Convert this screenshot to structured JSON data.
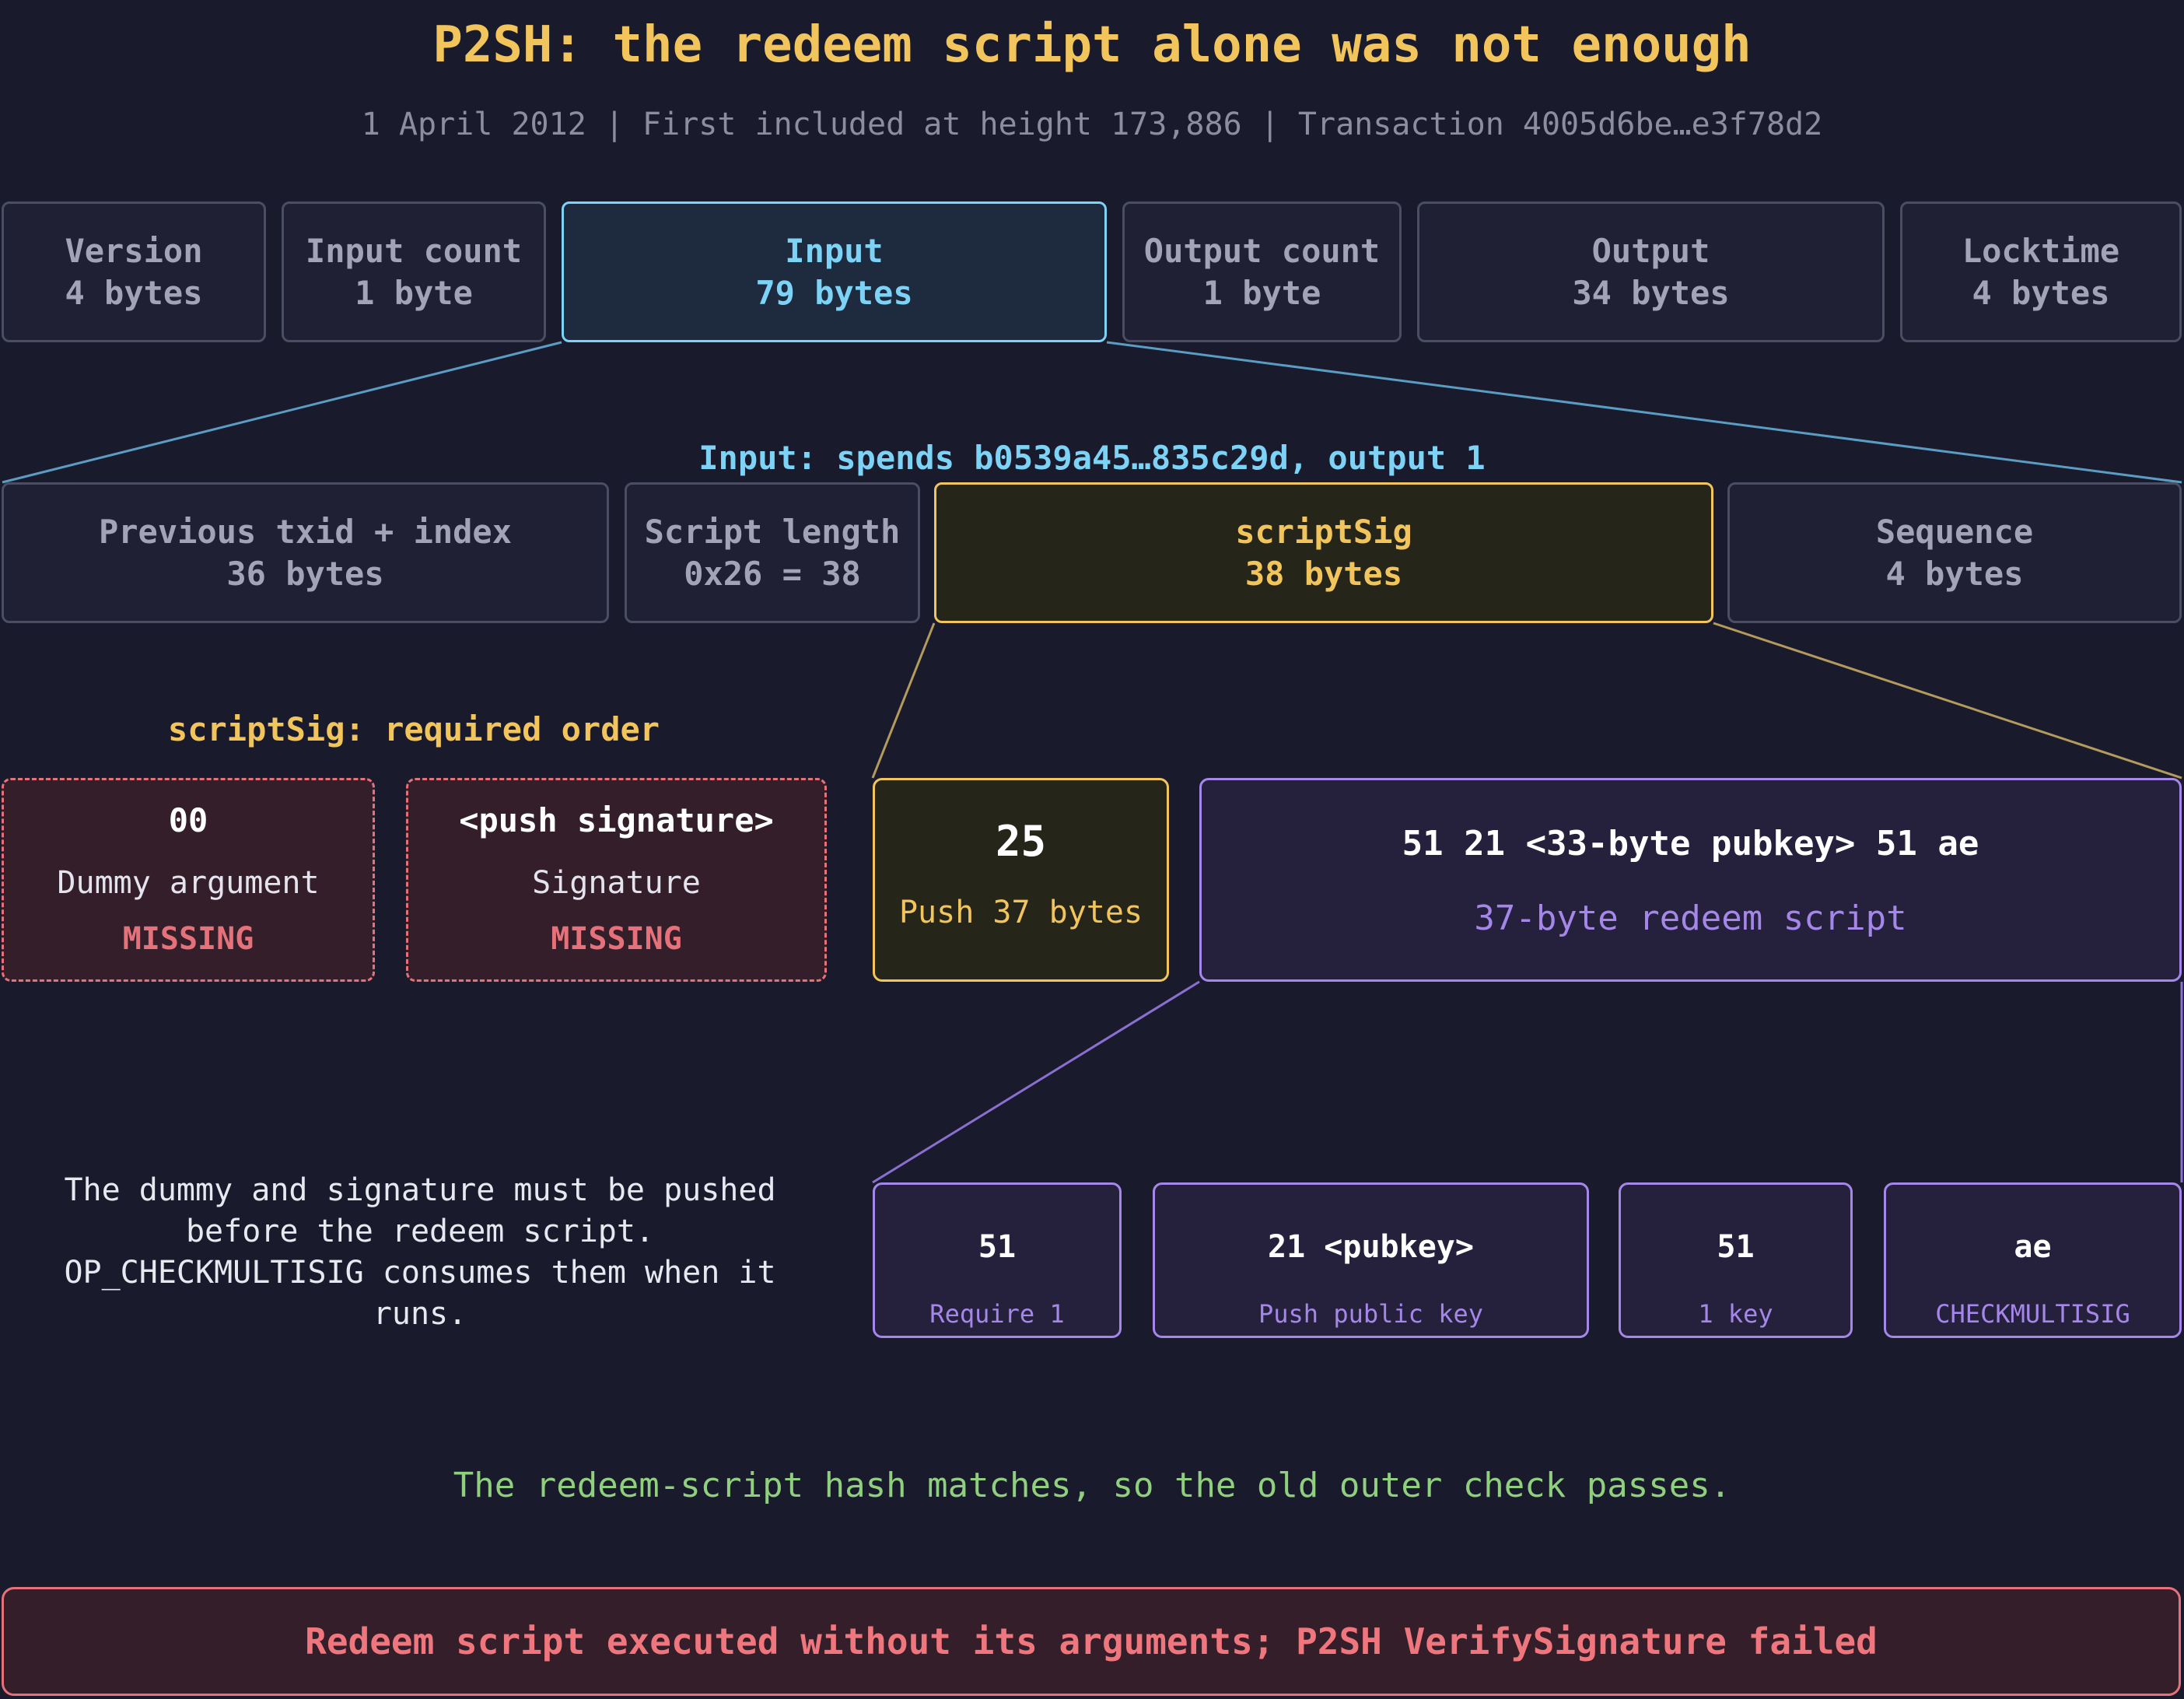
{
  "title": "P2SH: the redeem script alone was not enough",
  "subtitle": "1 April 2012 | First included at height 173,886 | Transaction 4005d6be…e3f78d2",
  "transaction_fields": [
    {
      "name": "Version",
      "size": "4 bytes"
    },
    {
      "name": "Input count",
      "size": "1 byte"
    },
    {
      "name": "Input",
      "size": "79 bytes"
    },
    {
      "name": "Output count",
      "size": "1 byte"
    },
    {
      "name": "Output",
      "size": "34 bytes"
    },
    {
      "name": "Locktime",
      "size": "4 bytes"
    }
  ],
  "input_caption": "Input: spends b0539a45…835c29d, output 1",
  "input_fields": [
    {
      "name": "Previous txid + index",
      "size": "36 bytes"
    },
    {
      "name": "Script length",
      "size": "0x26 = 38"
    },
    {
      "name": "scriptSig",
      "size": "38 bytes"
    },
    {
      "name": "Sequence",
      "size": "4 bytes"
    }
  ],
  "required_order": {
    "caption": "scriptSig: required order",
    "items": [
      {
        "hex": "00",
        "label": "Dummy argument",
        "status": "MISSING"
      },
      {
        "hex": "<push signature>",
        "label": "Signature",
        "status": "MISSING"
      }
    ]
  },
  "scriptsig_contents": {
    "push": {
      "hex": "25",
      "label": "Push 37 bytes"
    },
    "redeem": {
      "hex": "51 21 <33-byte pubkey> 51 ae",
      "label": "37-byte redeem script"
    }
  },
  "note": "The dummy and signature must be pushed before the redeem script. OP_CHECKMULTISIG consumes them when it runs.",
  "redeem_ops": [
    {
      "hex": "51",
      "label": "Require 1"
    },
    {
      "hex": "21 <pubkey>",
      "label": "Push public key"
    },
    {
      "hex": "51",
      "label": "1 key"
    },
    {
      "hex": "ae",
      "label": "CHECKMULTISIG"
    }
  ],
  "pass_message": "The redeem-script hash matches, so the old outer check passes.",
  "fail_message": "Redeem script executed without its arguments; P2SH VerifySignature failed",
  "colors": {
    "background": "#191a2c",
    "title": "#f2c55c",
    "input": "#7dd3f5",
    "scriptsig": "#f2c55c",
    "redeem": "#a587ea",
    "missing": "#e5727a",
    "pass": "#8fcf7d"
  }
}
